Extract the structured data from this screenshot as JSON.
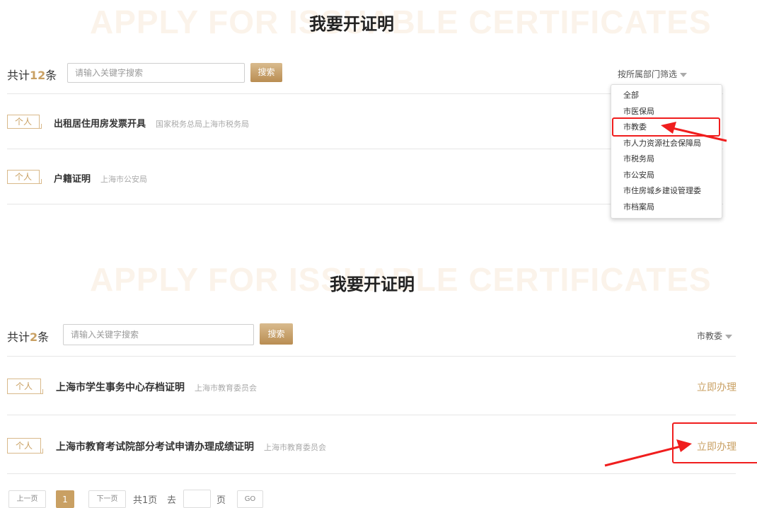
{
  "panel1": {
    "watermark": "APPLY FOR ISSUABLE CERTIFICATES",
    "heading": "我要开证明",
    "count_prefix": "共计",
    "count_num": "12",
    "count_suffix": "条",
    "search_placeholder": "请输入关键字搜索",
    "search_button": "搜索",
    "filter_label": "按所属部门筛选",
    "rows": [
      {
        "tag": "个人",
        "title": "出租居住用房发票开具",
        "dept": "国家税务总局上海市税务局"
      },
      {
        "tag": "个人",
        "title": "户籍证明",
        "dept": "上海市公安局"
      }
    ],
    "dropdown": [
      "全部",
      "市医保局",
      "市教委",
      "市人力资源社会保障局",
      "市税务局",
      "市公安局",
      "市住房城乡建设管理委",
      "市档案局"
    ]
  },
  "panel2": {
    "watermark": "APPLY FOR ISSUABLE CERTIFICATES",
    "heading": "我要开证明",
    "count_prefix": "共计",
    "count_num": "2",
    "count_suffix": "条",
    "search_placeholder": "请输入关键字搜索",
    "search_button": "搜索",
    "filter_label": "市教委",
    "rows": [
      {
        "tag": "个人",
        "title": "上海市学生事务中心存档证明",
        "dept": "上海市教育委员会",
        "action": "立即办理"
      },
      {
        "tag": "个人",
        "title": "上海市教育考试院部分考试申请办理成绩证明",
        "dept": "上海市教育委员会",
        "action": "立即办理"
      }
    ],
    "pager": {
      "prev": "上一页",
      "current": "1",
      "next": "下一页",
      "total": "共1页",
      "goto": "去",
      "page_unit": "页",
      "go": "GO"
    }
  },
  "colors": {
    "accent": "#c9a063",
    "annotation": "#f01e1e"
  }
}
